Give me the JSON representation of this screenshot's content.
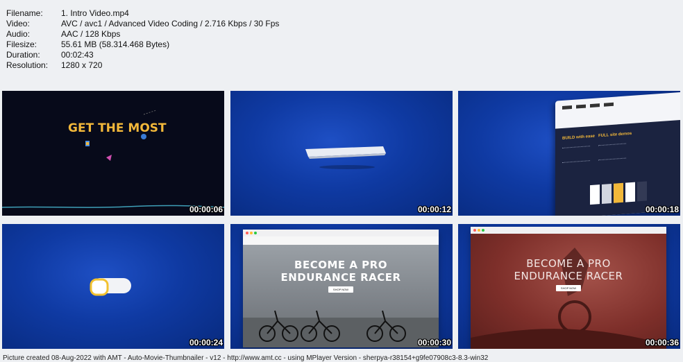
{
  "info": {
    "rows": [
      {
        "key": "Filename:",
        "value": "1. Intro Video.mp4"
      },
      {
        "key": "Video:",
        "value": "AVC / avc1 / Advanced Video Coding / 2.716 Kbps / 30 Fps"
      },
      {
        "key": "Audio:",
        "value": "AAC / 128 Kbps"
      },
      {
        "key": "Filesize:",
        "value": "55.61 MB (58.314.468 Bytes)"
      },
      {
        "key": "Duration:",
        "value": "00:02:43"
      },
      {
        "key": "Resolution:",
        "value": "1280 x 720"
      }
    ]
  },
  "thumbnails": [
    {
      "timestamp": "00:00:06",
      "text": "GET THE MOST"
    },
    {
      "timestamp": "00:00:12"
    },
    {
      "timestamp": "00:00:18",
      "col1": "BUILD with ease",
      "col2": "FULL site demos"
    },
    {
      "timestamp": "00:00:24"
    },
    {
      "timestamp": "00:00:30",
      "hero_line1": "BECOME A PRO",
      "hero_line2": "ENDURANCE RACER",
      "button": "SHOP NOW"
    },
    {
      "timestamp": "00:00:36",
      "hero_line1": "BECOME A PRO",
      "hero_line2": "ENDURANCE RACER",
      "button": "SHOP NOW"
    }
  ],
  "footer": "Picture created 08-Aug-2022 with AMT - Auto-Movie-Thumbnailer - v12 - http://www.amt.cc - using MPlayer Version - sherpya-r38154+g9fe07908c3-8.3-win32",
  "colors": {
    "background": "#eef0f3",
    "headline_gold": "#f2b83a",
    "blue_bg": "#0f3aa3",
    "red_tint": "#8a2f2a"
  }
}
